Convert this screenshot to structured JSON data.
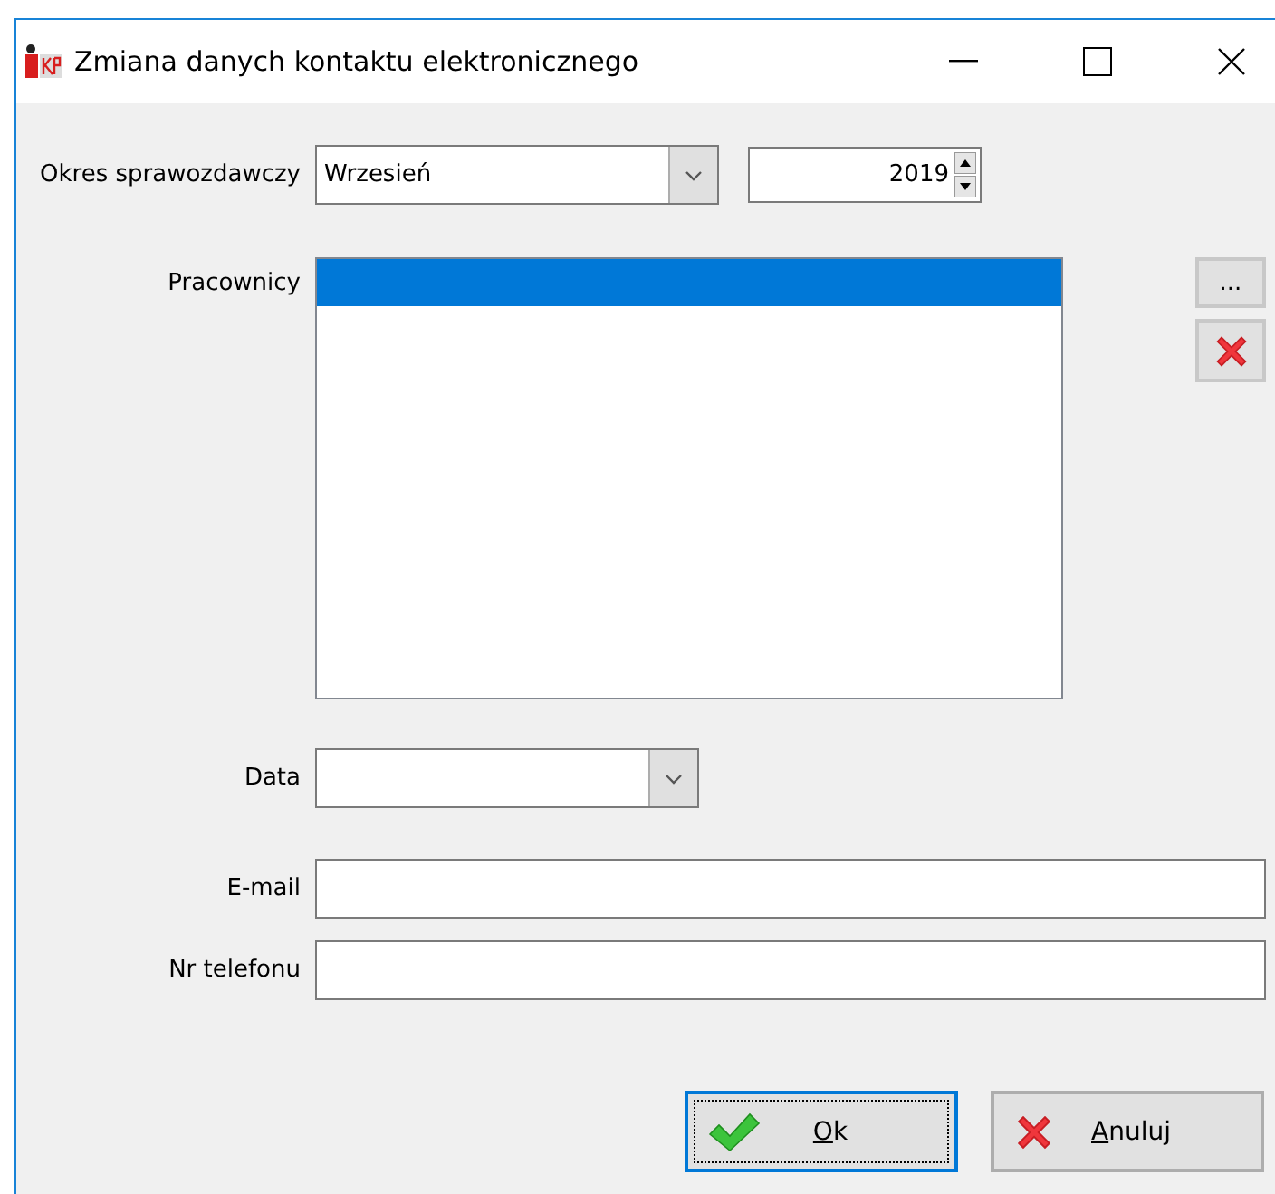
{
  "window": {
    "title": "Zmiana danych kontaktu elektronicznego"
  },
  "period": {
    "label": "Okres sprawozdawczy",
    "month": "Wrzesień",
    "year": "2019"
  },
  "employees": {
    "label": "Pracownicy",
    "rows": [
      {
        "selected": true
      }
    ],
    "browse_button": "..."
  },
  "date": {
    "label": "Data"
  },
  "email": {
    "label": "E-mail"
  },
  "phone": {
    "label": "Nr telefonu"
  },
  "buttons": [
    {
      "kind": "ok",
      "access_key": "O",
      "label_rest": "k",
      "default": true
    },
    {
      "kind": "cancel",
      "access_key": "A",
      "label_rest": "nuluj",
      "default": false
    }
  ]
}
